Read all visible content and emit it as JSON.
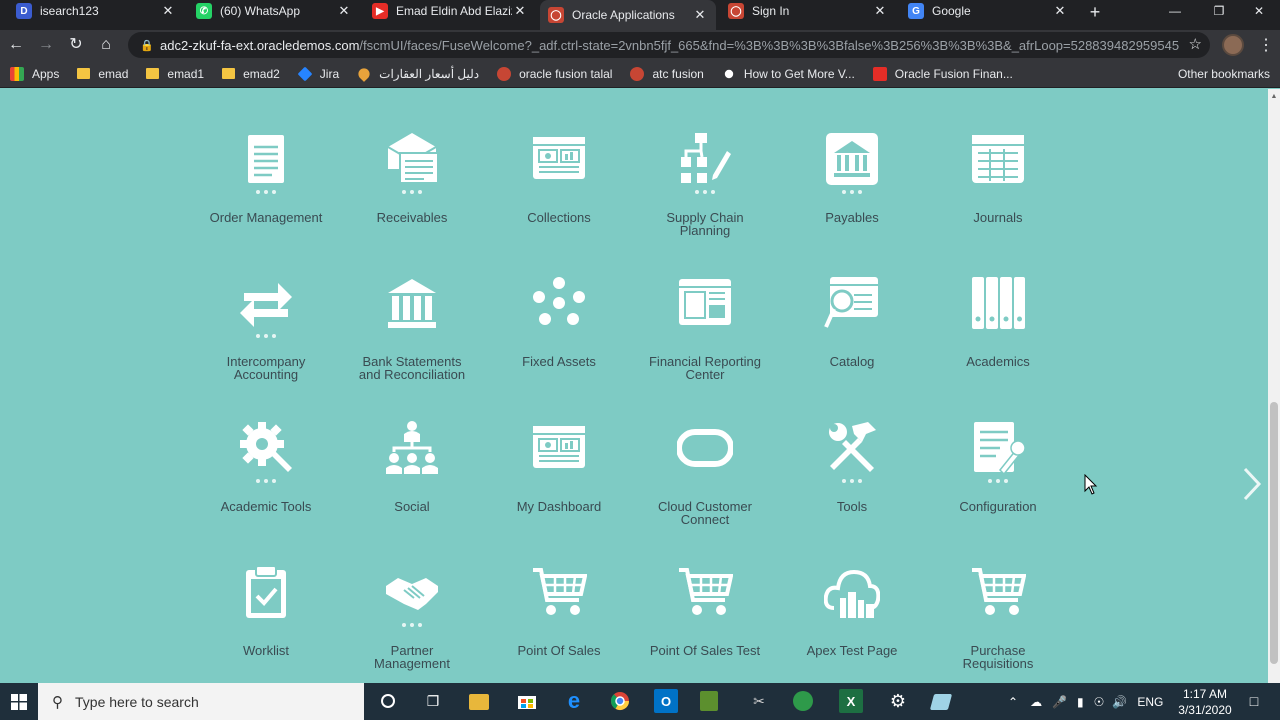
{
  "browser": {
    "tabs": [
      {
        "title": "isearch123",
        "icon": "d-icon",
        "color": "#3b5ccf",
        "glyph": "D"
      },
      {
        "title": "(60) WhatsApp",
        "icon": "whatsapp-icon",
        "color": "#25d366",
        "glyph": "✆"
      },
      {
        "title": "Emad Eldin Abd Elaziz -",
        "icon": "youtube-icon",
        "color": "#e52d27",
        "glyph": "▶"
      },
      {
        "title": "Oracle Applications",
        "icon": "oracle-icon",
        "color": "#c74634",
        "glyph": "◯"
      },
      {
        "title": "Sign In",
        "icon": "oracle-icon",
        "color": "#c74634",
        "glyph": "◯"
      },
      {
        "title": "Google",
        "icon": "google-icon",
        "color": "#4285f4",
        "glyph": "G"
      }
    ],
    "active_tab_index": 3,
    "url_host": "adc2-zkuf-fa-ext.oracledemos.com",
    "url_rest": "/fscmUI/faces/FuseWelcome?_adf.ctrl-state=2vnbn5fjf_665&fnd=%3B%3B%3B%3Bfalse%3B256%3B%3B%3B&_afrLoop=528839482959545",
    "bookmarks": [
      {
        "label": "Apps",
        "kind": "apps"
      },
      {
        "label": "emad",
        "kind": "folder"
      },
      {
        "label": "emad1",
        "kind": "folder"
      },
      {
        "label": "emad2",
        "kind": "folder"
      },
      {
        "label": "Jira",
        "kind": "jira"
      },
      {
        "label": "دليل أسعار العقارات",
        "kind": "pin"
      },
      {
        "label": "oracle fusion talal",
        "kind": "ora"
      },
      {
        "label": "atc fusion",
        "kind": "ora"
      },
      {
        "label": "How to Get More V...",
        "kind": "star"
      },
      {
        "label": "Oracle Fusion Finan...",
        "kind": "yt"
      }
    ],
    "other_bookmarks": "Other bookmarks"
  },
  "springboard": {
    "tiles": [
      {
        "label": "Order Management",
        "icon": "order-document-icon",
        "dots": true
      },
      {
        "label": "Receivables",
        "icon": "envelope-invoice-icon",
        "dots": true
      },
      {
        "label": "Collections",
        "icon": "dashboard-window-icon",
        "dots": false
      },
      {
        "label": "Supply Chain\nPlanning",
        "icon": "supply-chain-icon",
        "dots": true
      },
      {
        "label": "Payables",
        "icon": "bank-building-icon",
        "dots": true
      },
      {
        "label": "Journals",
        "icon": "ledger-grid-icon",
        "dots": false
      },
      {
        "label": "Intercompany\nAccounting",
        "icon": "exchange-arrows-icon",
        "dots": true
      },
      {
        "label": "Bank Statements\nand Reconciliation",
        "icon": "bank-columns-icon",
        "dots": false
      },
      {
        "label": "Fixed Assets",
        "icon": "cycle-assets-icon",
        "dots": false
      },
      {
        "label": "Financial Reporting\nCenter",
        "icon": "report-window-icon",
        "dots": false
      },
      {
        "label": "Catalog",
        "icon": "catalog-search-icon",
        "dots": false
      },
      {
        "label": "Academics",
        "icon": "binders-icon",
        "dots": false
      },
      {
        "label": "Academic Tools",
        "icon": "gear-wrench-icon",
        "dots": true
      },
      {
        "label": "Social",
        "icon": "org-people-icon",
        "dots": false
      },
      {
        "label": "My Dashboard",
        "icon": "dashboard-window-icon",
        "dots": false
      },
      {
        "label": "Cloud Customer\nConnect",
        "icon": "oracle-ring-icon",
        "dots": false
      },
      {
        "label": "Tools",
        "icon": "hammer-wrench-icon",
        "dots": true
      },
      {
        "label": "Configuration",
        "icon": "config-document-icon",
        "dots": true
      },
      {
        "label": "Worklist",
        "icon": "clipboard-check-icon",
        "dots": false
      },
      {
        "label": "Partner\nManagement",
        "icon": "handshake-icon",
        "dots": true
      },
      {
        "label": "Point Of Sales",
        "icon": "shopping-cart-icon",
        "dots": false
      },
      {
        "label": "Point Of Sales Test",
        "icon": "shopping-cart-icon",
        "dots": false
      },
      {
        "label": "Apex Test Page",
        "icon": "cloud-city-icon",
        "dots": false
      },
      {
        "label": "Purchase\nRequisitions",
        "icon": "shopping-cart-icon",
        "dots": false
      }
    ]
  },
  "taskbar": {
    "search_placeholder": "Type here to search",
    "language": "ENG",
    "time": "1:17 AM",
    "date": "3/31/2020"
  }
}
